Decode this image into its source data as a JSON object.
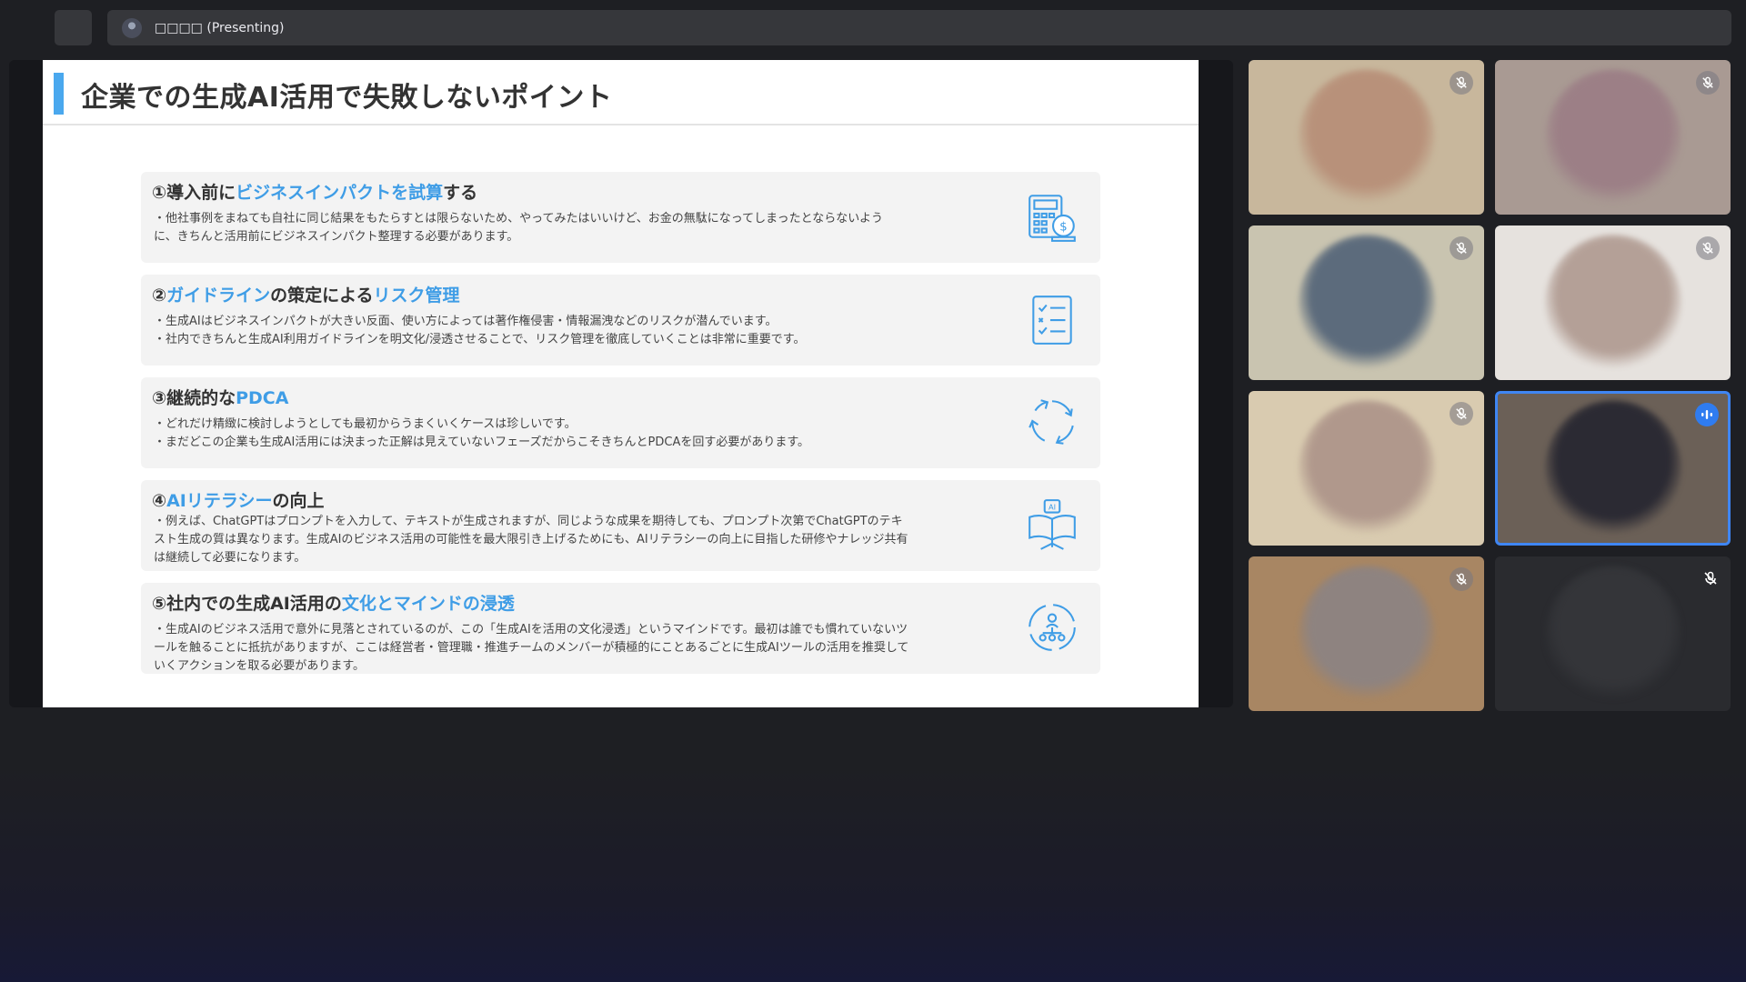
{
  "topbar": {
    "presenter_label": "□□□□ (Presenting)"
  },
  "slide": {
    "title": "企業での生成AI活用で失敗しないポイント",
    "points": [
      {
        "head_before": "①導入前に",
        "head_highlight": "ビジネスインパクトを試算",
        "head_after": "する",
        "body": [
          "・他社事例をまねても自社に同じ結果をもたらすとは限らないため、やってみたはいいけど、お金の無駄になってしまったとならないよう",
          "に、きちんと活用前にビジネスインパクト整理する必要があります。"
        ],
        "icon": "calculator-coin-icon"
      },
      {
        "head_before": "②",
        "head_highlight": "ガイドライン",
        "head_after": "の策定による",
        "head_highlight2": "リスク管理",
        "body": [
          "・生成AIはビジネスインパクトが大きい反面、使い方によっては著作権侵害・情報漏洩などのリスクが潜んでいます。",
          "・社内できちんと生成AI利用ガイドラインを明文化/浸透させることで、リスク管理を徹底していくことは非常に重要です。"
        ],
        "icon": "checklist-icon"
      },
      {
        "head_before": "③継続的な",
        "head_highlight": "PDCA",
        "head_after": "",
        "body": [
          "・どれだけ精緻に検討しようとしても最初からうまくいくケースは珍しいです。",
          "・まだどこの企業も生成AI活用には決まった正解は見えていないフェーズだからこそきちんとPDCAを回す必要があります。"
        ],
        "icon": "cycle-arrows-icon"
      },
      {
        "head_before": "④",
        "head_highlight": "AIリテラシー",
        "head_after": "の向上",
        "body": [
          "・例えば、ChatGPTはプロンプトを入力して、テキストが生成されますが、同じような成果を期待しても、プロンプト次第でChatGPTのテキ",
          "スト生成の質は異なります。生成AIのビジネス活用の可能性を最大限引き上げるためにも、AIリテラシーの向上に目指した研修やナレッジ共有",
          "は継続して必要になります。"
        ],
        "icon": "ai-book-icon",
        "icon_text": "AI"
      },
      {
        "head_before": "⑤社内での生成AI活用の",
        "head_highlight": "文化とマインドの浸透",
        "head_after": "",
        "body": [
          "・生成AIのビジネス活用で意外に見落とされているのが、この「生成AIを活用の文化浸透」というマインドです。最初は誰でも慣れていないツ",
          "ールを触ることに抵抗がありますが、ここは経営者・管理職・推進チームのメンバーが積極的にことあるごとに生成AIツールの活用を推奨して",
          "いくアクションを取る必要があります。"
        ],
        "icon": "team-network-icon"
      }
    ]
  },
  "participants": [
    {
      "state": "muted",
      "bg": "#c8b79c",
      "face": "#b8917a"
    },
    {
      "state": "muted",
      "bg": "#a99a93",
      "face": "#9c7f86"
    },
    {
      "state": "muted",
      "bg": "#c9c4b0",
      "face": "#5c6b7c"
    },
    {
      "state": "muted",
      "bg": "#e6e2de",
      "face": "#b4a097"
    },
    {
      "state": "muted",
      "bg": "#d9cbb0",
      "face": "#b0988c"
    },
    {
      "state": "speaking",
      "bg": "#6b6057",
      "face": "#2b2a33"
    },
    {
      "state": "muted",
      "bg": "#a88663",
      "face": "#8e8380"
    },
    {
      "state": "muted-camera-off",
      "bg": "#2a2b2f",
      "face": "#343539"
    }
  ],
  "colors": {
    "accent_blue": "#3f9de6",
    "speaking_border": "#3f86f3",
    "background": "#1e1f23"
  }
}
